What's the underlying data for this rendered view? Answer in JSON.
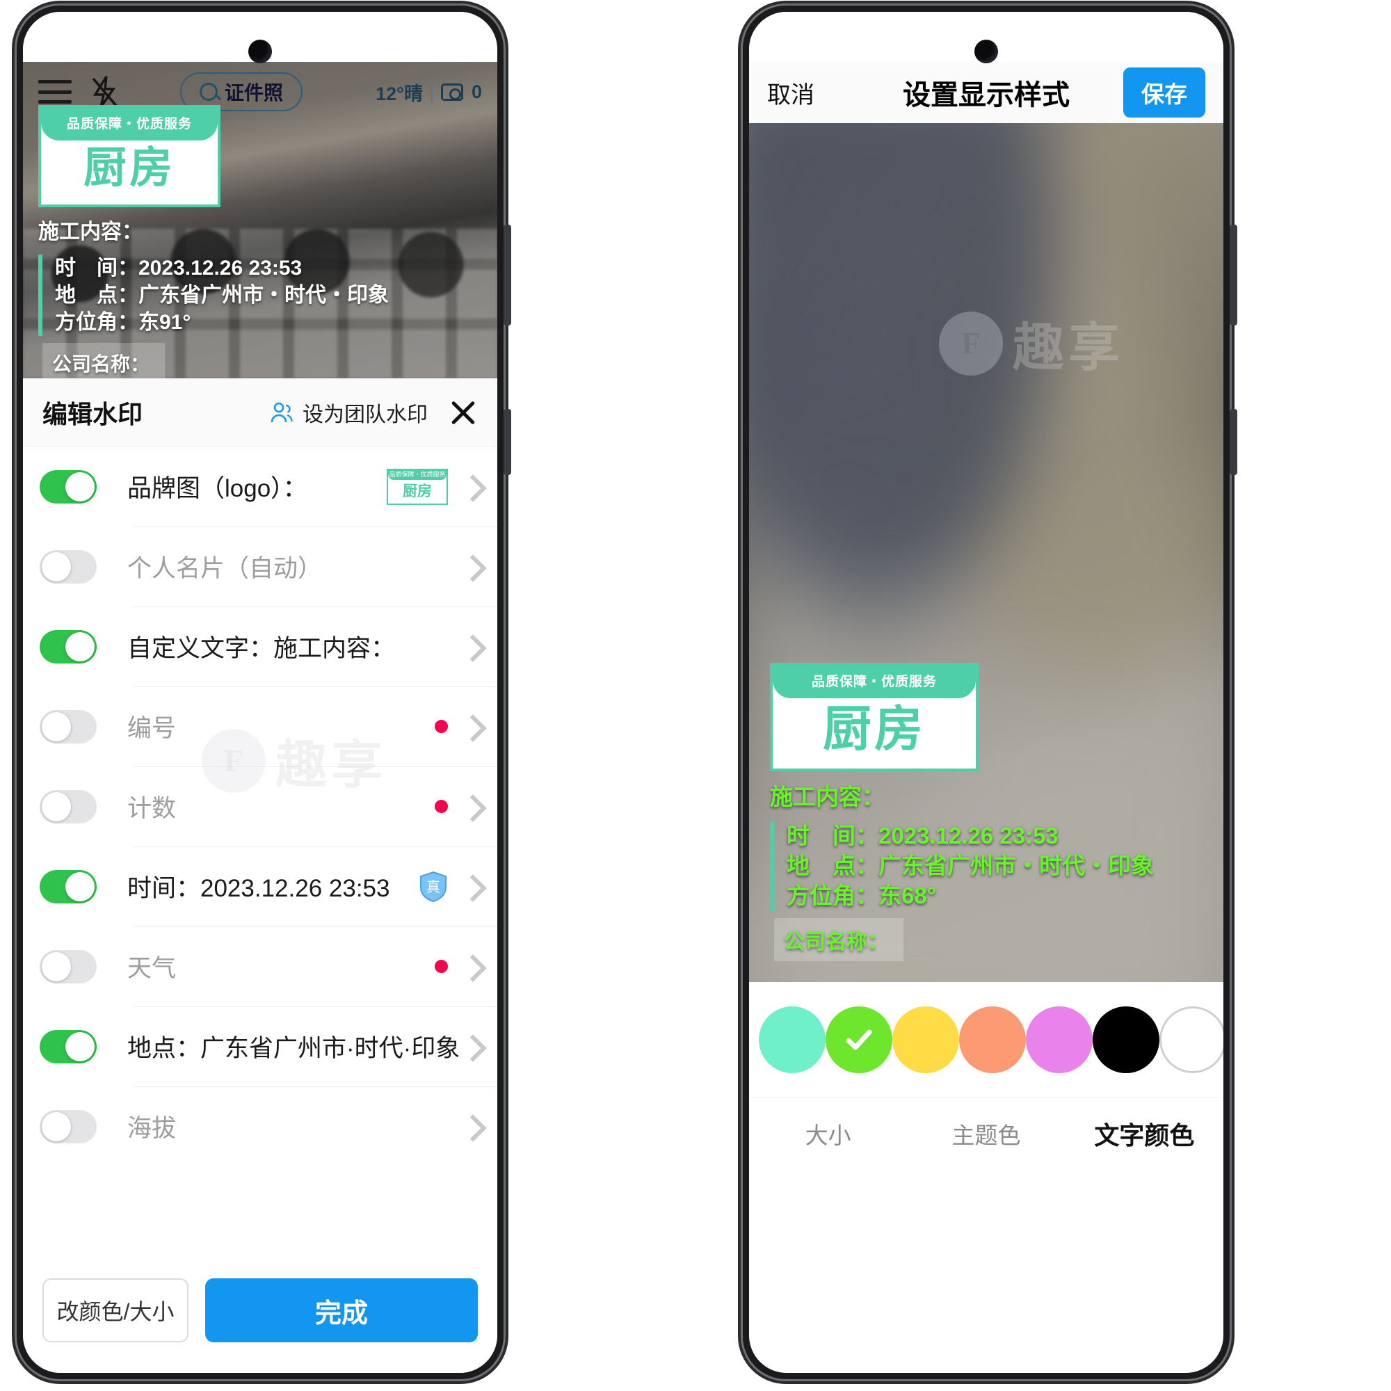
{
  "left_phone": {
    "camera_bar": {
      "menu_icon": "hamburger-icon",
      "flash_icon": "flash-off-icon",
      "search_pill_label": "证件照",
      "search_icon": "search-icon",
      "weather": "12°晴",
      "camera_icon": "camera-icon",
      "photo_count": "0"
    },
    "watermark": {
      "ribbon": "品质保障・优质服务",
      "big_text": "厨房",
      "title": "施工内容：",
      "rows": [
        "时　间：2023.12.26 23:53",
        "地　点：广东省广州市・时代・印象",
        "方位角：东91°"
      ],
      "company": "公司名称："
    },
    "sheet": {
      "title": "编辑水印",
      "team_label": "设为团队水印",
      "team_icon": "team-user-icon",
      "close_icon": "close-icon",
      "rows": [
        {
          "label": "品牌图（logo）：",
          "on": true,
          "dim": false,
          "badge": "thumb",
          "thumb_ribbon": "品质保障・优质服务",
          "thumb_text": "厨房"
        },
        {
          "label": "个人名片（自动）",
          "on": false,
          "dim": true,
          "badge": "none"
        },
        {
          "label": "自定义文字：施工内容：",
          "on": true,
          "dim": false,
          "badge": "none"
        },
        {
          "label": "编号",
          "on": false,
          "dim": true,
          "badge": "dot"
        },
        {
          "label": "计数",
          "on": false,
          "dim": true,
          "badge": "dot"
        },
        {
          "label": "时间：2023.12.26 23:53",
          "on": true,
          "dim": false,
          "badge": "shield",
          "shield_text": "真"
        },
        {
          "label": "天气",
          "on": false,
          "dim": true,
          "badge": "dot"
        },
        {
          "label": "地点：广东省广州市·时代·印象",
          "on": true,
          "dim": false,
          "badge": "none"
        },
        {
          "label": "海拔",
          "on": false,
          "dim": true,
          "badge": "none"
        }
      ],
      "secondary_button": "改颜色/大小",
      "primary_button": "完成"
    }
  },
  "right_phone": {
    "header": {
      "cancel": "取消",
      "title": "设置显示样式",
      "save": "保存"
    },
    "watermark": {
      "ribbon": "品质保障・优质服务",
      "big_text": "厨房",
      "title": "施工内容：",
      "rows": [
        "时　间：2023.12.26 23:53",
        "地　点：广东省广州市・时代・印象",
        "方位角：东68°"
      ],
      "company": "公司名称："
    },
    "swatches": [
      {
        "color": "#6ff0c8",
        "selected": false,
        "ring": false
      },
      {
        "color": "#6ee62e",
        "selected": true,
        "ring": false
      },
      {
        "color": "#ffdb46",
        "selected": false,
        "ring": false
      },
      {
        "color": "#fb9a73",
        "selected": false,
        "ring": false
      },
      {
        "color": "#ea82ec",
        "selected": false,
        "ring": false
      },
      {
        "color": "#000000",
        "selected": false,
        "ring": false
      },
      {
        "color": "#ffffff",
        "selected": false,
        "ring": true
      }
    ],
    "tabs": [
      {
        "label": "大小",
        "active": false
      },
      {
        "label": "主题色",
        "active": false
      },
      {
        "label": "文字颜色",
        "active": true
      }
    ]
  },
  "stamp": {
    "mark": "F",
    "text": "趣享"
  },
  "colors": {
    "brand_green": "#4fcfa8",
    "toggle_on": "#2fc24d",
    "primary_blue": "#1296f0",
    "badge_red": "#f5054f",
    "neon_green": "#6bf22e"
  }
}
